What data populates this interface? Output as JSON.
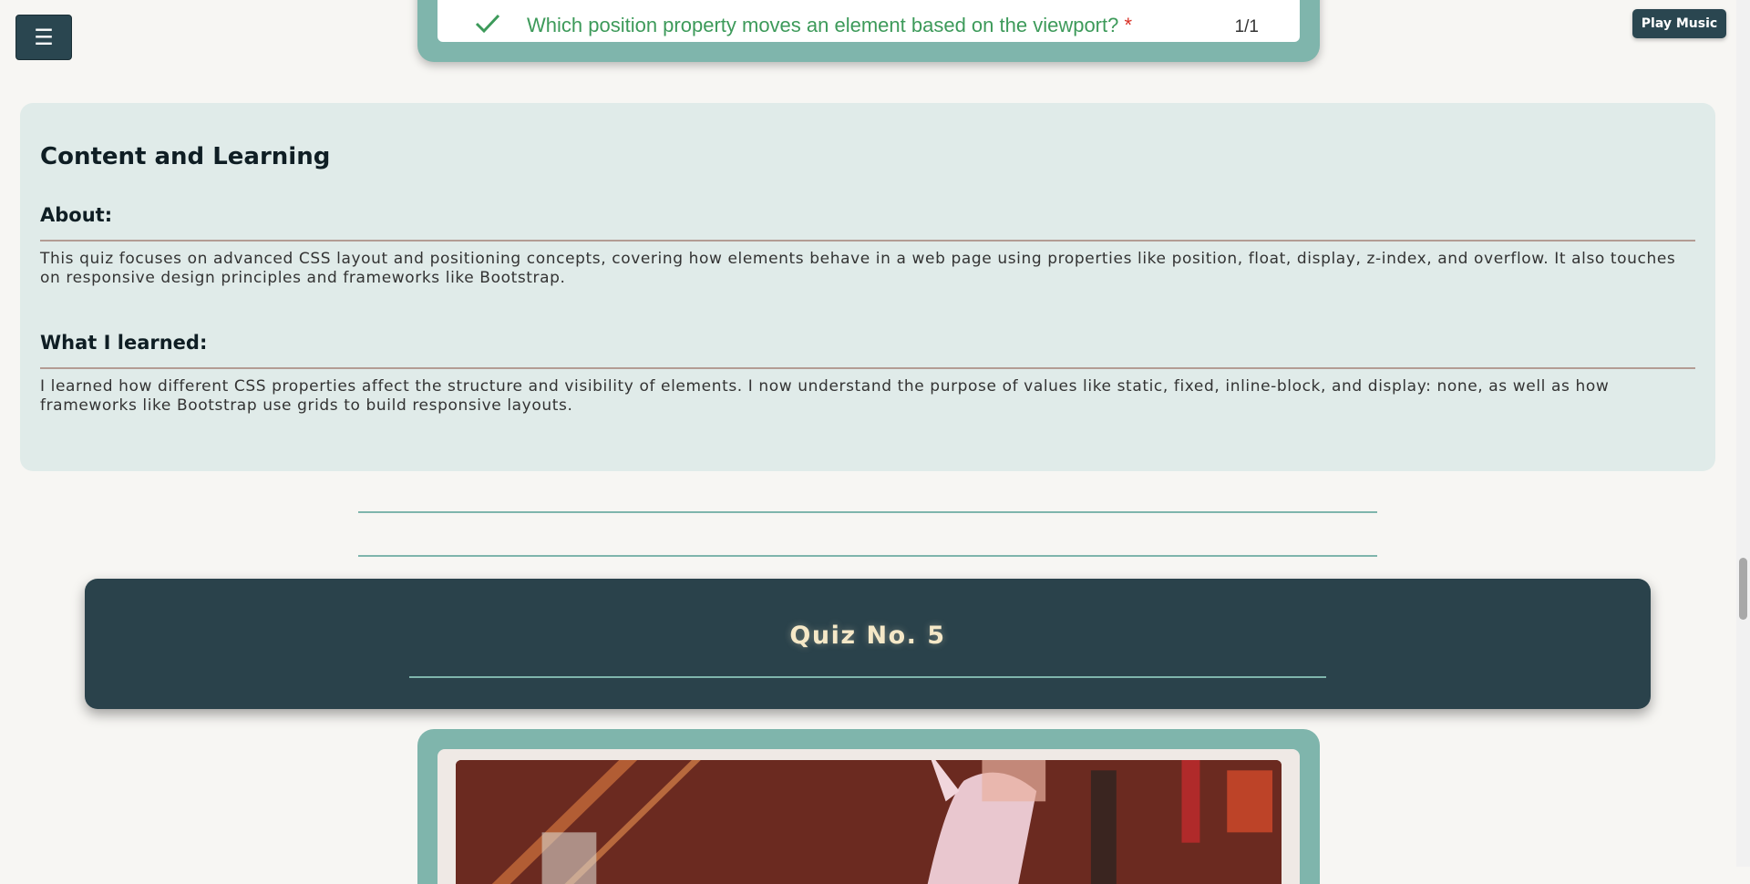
{
  "header": {
    "menu_icon": "☰",
    "music_label": "Play Music"
  },
  "quiz_prev": {
    "question": "Which position property moves an element based on the viewport?",
    "required_mark": "*",
    "score": "1/1",
    "status_icon": "check-icon",
    "status_color": "#3d9a5a"
  },
  "content": {
    "title": "Content and Learning",
    "about_heading": "About:",
    "about_text": "This quiz focuses on advanced CSS layout and positioning concepts, covering how elements behave in a web page using properties like position, float, display, z-index, and overflow. It also touches on responsive design principles and frameworks like Bootstrap.",
    "learned_heading": "What I learned:",
    "learned_text": "I learned how different CSS properties affect the structure and visibility of elements. I now understand the purpose of values like static, fixed, inline-block, and display: none, as well as how frameworks like Bootstrap use grids to build responsive layouts."
  },
  "next_quiz": {
    "title": "Quiz No. 5"
  },
  "colors": {
    "accent": "#7fb5ac",
    "dark": "#2a424b",
    "banner_text": "#f5e8c7",
    "content_bg": "#e0ebe9"
  }
}
